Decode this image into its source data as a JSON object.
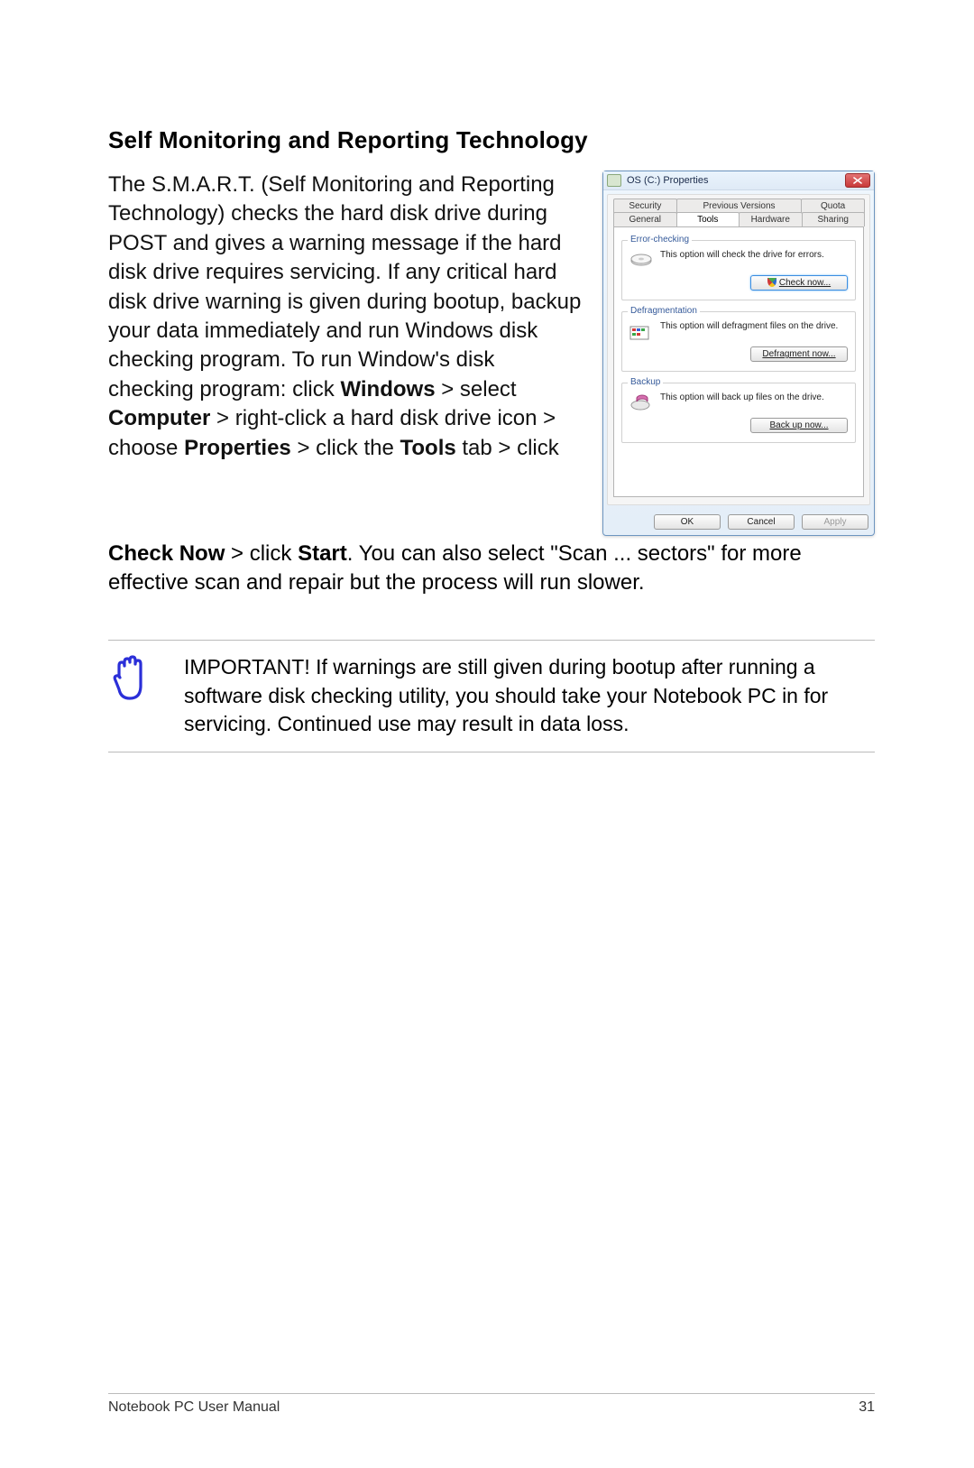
{
  "heading": "Self Monitoring and Reporting Technology",
  "body": {
    "p1a": "The S.M.A.R.T. (Self Monitoring and Reporting Technology) checks the hard disk drive during POST and gives a warning message if the hard disk drive requires servicing. If any critical hard disk drive warning is given during bootup, backup your data immediately and run Windows disk checking program. To run Window's disk checking program: click ",
    "b_windows": "Windows",
    "gt1": " > select ",
    "b_computer": "Computer",
    "gt2": " > right-click a hard disk drive icon > choose ",
    "b_properties": "Properties",
    "gt3": " > click the ",
    "b_tools": "Tools",
    "gt4": " tab > click ",
    "b_checknow": "Check Now",
    "gt5": " > click ",
    "b_start": "Start",
    "p1b": ". You can also select \"Scan ... sectors\" for more effective scan and repair but the process will run slower."
  },
  "note": "IMPORTANT! If warnings are still given during bootup after running a software disk checking utility, you should take your Notebook PC in for servicing. Continued use may result in data loss.",
  "dialog": {
    "title": "OS (C:) Properties",
    "tabs_top": [
      "Security",
      "Previous Versions",
      "Quota"
    ],
    "tabs_bottom": [
      "General",
      "Tools",
      "Hardware",
      "Sharing"
    ],
    "active_tab": "Tools",
    "groups": {
      "error": {
        "title": "Error-checking",
        "desc": "This option will check the drive for errors.",
        "button": "Check now..."
      },
      "defrag": {
        "title": "Defragmentation",
        "desc": "This option will defragment files on the drive.",
        "button": "Defragment now..."
      },
      "backup": {
        "title": "Backup",
        "desc": "This option will back up files on the drive.",
        "button": "Back up now..."
      }
    },
    "actions": {
      "ok": "OK",
      "cancel": "Cancel",
      "apply": "Apply"
    }
  },
  "footer": {
    "left": "Notebook PC User Manual",
    "right": "31"
  }
}
